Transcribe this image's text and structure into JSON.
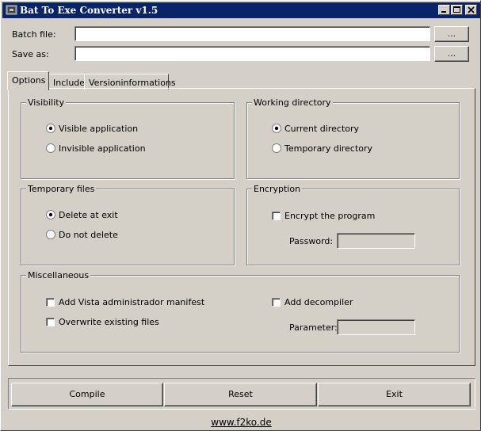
{
  "window": {
    "title": "Bat To Exe Converter v1.5",
    "title_color": "#0a246a"
  },
  "files": {
    "batch_label": "Batch file:",
    "batch_value": "",
    "save_label": "Save as:",
    "save_value": "",
    "browse_label": "..."
  },
  "tabs": [
    {
      "label": "Options",
      "selected": true
    },
    {
      "label": "Include",
      "selected": false
    },
    {
      "label": "Versioninformations",
      "selected": false
    }
  ],
  "visibility": {
    "title": "Visibility",
    "options": [
      {
        "label": "Visible application",
        "checked": true
      },
      {
        "label": "Invisible application",
        "checked": false
      }
    ]
  },
  "working_directory": {
    "title": "Working directory",
    "options": [
      {
        "label": "Current directory",
        "checked": true
      },
      {
        "label": "Temporary directory",
        "checked": false
      }
    ]
  },
  "temporary_files": {
    "title": "Temporary files",
    "options": [
      {
        "label": "Delete at exit",
        "checked": true
      },
      {
        "label": "Do not delete",
        "checked": false
      }
    ]
  },
  "encryption": {
    "title": "Encryption",
    "encrypt_label": "Encrypt the program",
    "encrypt_checked": false,
    "password_label": "Password:",
    "password_value": ""
  },
  "misc": {
    "title": "Miscellaneous",
    "vista_label": "Add Vista administrador manifest",
    "vista_checked": false,
    "overwrite_label": "Overwrite existing files",
    "overwrite_checked": false,
    "decompiler_label": "Add decompiler",
    "decompiler_checked": false,
    "parameter_label": "Parameter:",
    "parameter_value": ""
  },
  "actions": {
    "compile": "Compile",
    "reset": "Reset",
    "exit": "Exit"
  },
  "footer": {
    "link": "www.f2ko.de"
  }
}
